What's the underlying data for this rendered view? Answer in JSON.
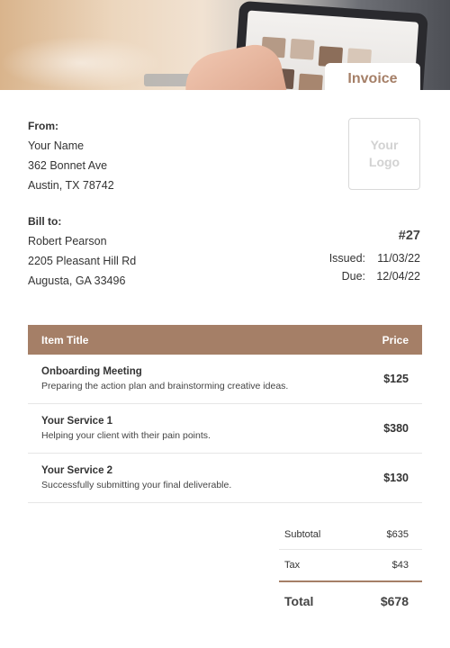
{
  "header": {
    "tab_label": "Invoice"
  },
  "colors": {
    "accent": "#a57f67",
    "text": "#333333",
    "divider": "#e6e6e6",
    "logo_placeholder": "#d2d2d2"
  },
  "from": {
    "heading": "From:",
    "name": "Your Name",
    "address_line1": "362 Bonnet Ave",
    "address_line2": "Austin, TX 78742"
  },
  "bill_to": {
    "heading": "Bill to:",
    "name": "Robert Pearson",
    "address_line1": "2205 Pleasant Hill Rd",
    "address_line2": "Augusta, GA 33496"
  },
  "logo": {
    "line1": "Your",
    "line2": "Logo"
  },
  "invoice": {
    "number": "#27",
    "issued_label": "Issued:",
    "issued_date": "11/03/22",
    "due_label": "Due:",
    "due_date": "12/04/22"
  },
  "table": {
    "col_item": "Item Title",
    "col_price": "Price",
    "items": [
      {
        "title": "Onboarding Meeting",
        "description": "Preparing the action plan and brainstorming creative ideas.",
        "price": "$125"
      },
      {
        "title": "Your Service 1",
        "description": "Helping your client with their pain points.",
        "price": "$380"
      },
      {
        "title": "Your Service 2",
        "description": "Successfully submitting your final deliverable.",
        "price": "$130"
      }
    ]
  },
  "totals": {
    "subtotal_label": "Subtotal",
    "subtotal_value": "$635",
    "tax_label": "Tax",
    "tax_value": "$43",
    "total_label": "Total",
    "total_value": "$678"
  }
}
